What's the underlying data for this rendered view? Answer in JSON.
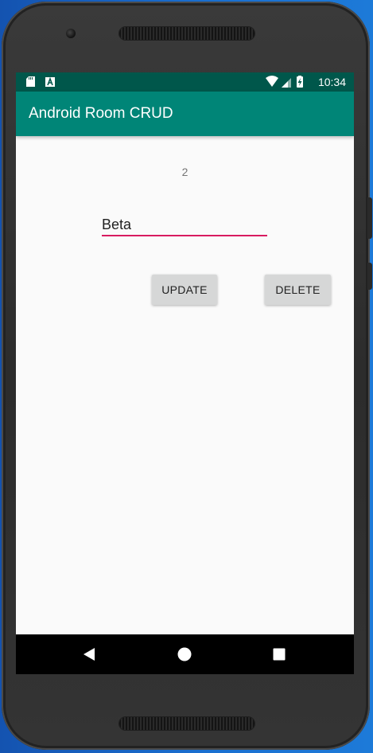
{
  "status_bar": {
    "time": "10:34",
    "left_icons": [
      "sd-card-icon",
      "a-notification-icon"
    ],
    "right_icons": [
      "wifi-icon",
      "signal-icon",
      "battery-charging-icon"
    ]
  },
  "app_bar": {
    "title": "Android Room CRUD",
    "color": "#008577",
    "status_color": "#00574b"
  },
  "content": {
    "record_id": "2",
    "name_field": {
      "value": "Beta",
      "underline_color": "#d81b60"
    },
    "buttons": {
      "update_label": "UPDATE",
      "delete_label": "DELETE"
    }
  },
  "nav_bar": {
    "buttons": [
      "back-icon",
      "home-icon",
      "recents-icon"
    ]
  }
}
